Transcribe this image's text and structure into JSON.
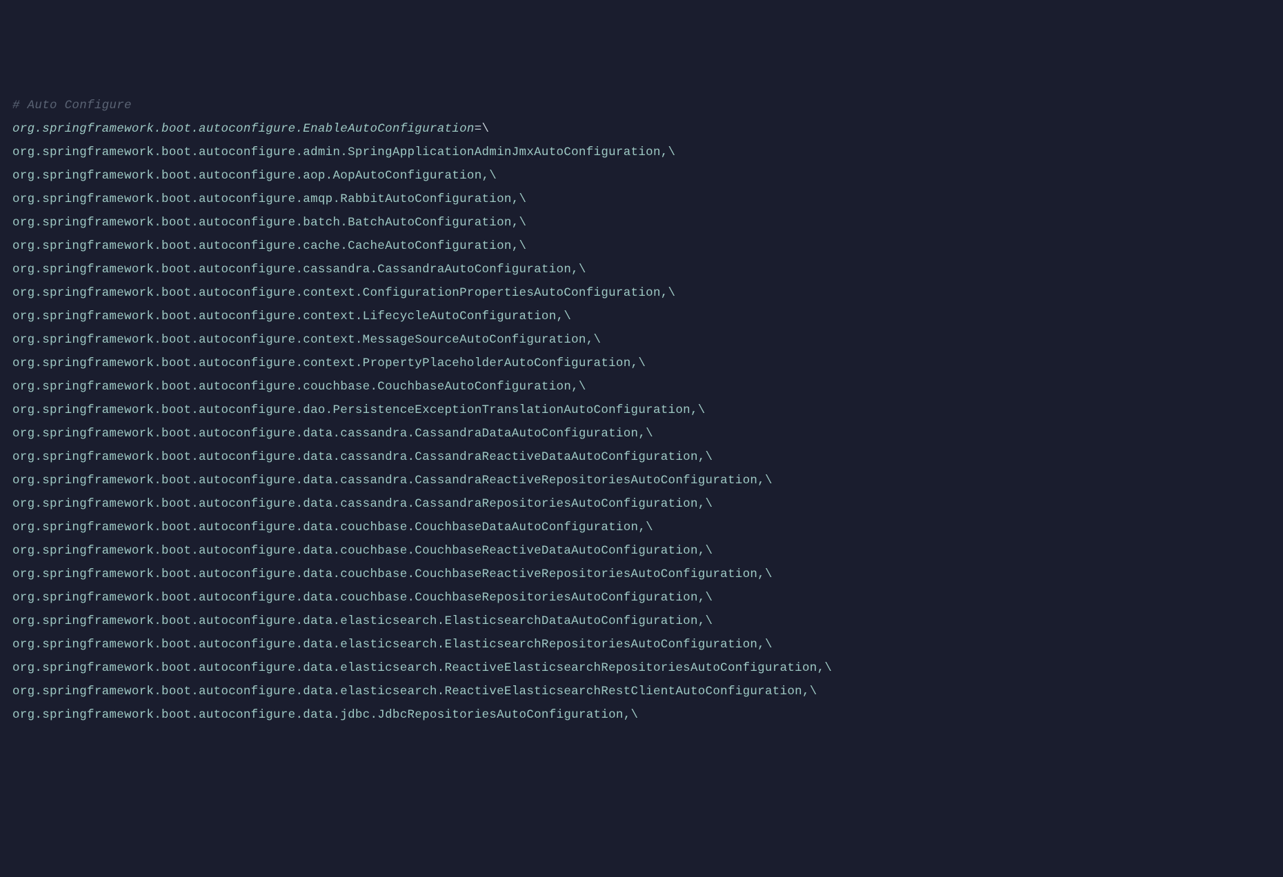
{
  "code": {
    "comment": "# Auto Configure",
    "key": "org.springframework.boot.autoconfigure.EnableAutoConfiguration",
    "equals_continuation": "=\\",
    "entries": [
      "org.springframework.boot.autoconfigure.admin.SpringApplicationAdminJmxAutoConfiguration,\\",
      "org.springframework.boot.autoconfigure.aop.AopAutoConfiguration,\\",
      "org.springframework.boot.autoconfigure.amqp.RabbitAutoConfiguration,\\",
      "org.springframework.boot.autoconfigure.batch.BatchAutoConfiguration,\\",
      "org.springframework.boot.autoconfigure.cache.CacheAutoConfiguration,\\",
      "org.springframework.boot.autoconfigure.cassandra.CassandraAutoConfiguration,\\",
      "org.springframework.boot.autoconfigure.context.ConfigurationPropertiesAutoConfiguration,\\",
      "org.springframework.boot.autoconfigure.context.LifecycleAutoConfiguration,\\",
      "org.springframework.boot.autoconfigure.context.MessageSourceAutoConfiguration,\\",
      "org.springframework.boot.autoconfigure.context.PropertyPlaceholderAutoConfiguration,\\",
      "org.springframework.boot.autoconfigure.couchbase.CouchbaseAutoConfiguration,\\",
      "org.springframework.boot.autoconfigure.dao.PersistenceExceptionTranslationAutoConfiguration,\\",
      "org.springframework.boot.autoconfigure.data.cassandra.CassandraDataAutoConfiguration,\\",
      "org.springframework.boot.autoconfigure.data.cassandra.CassandraReactiveDataAutoConfiguration,\\",
      "org.springframework.boot.autoconfigure.data.cassandra.CassandraReactiveRepositoriesAutoConfiguration,\\",
      "org.springframework.boot.autoconfigure.data.cassandra.CassandraRepositoriesAutoConfiguration,\\",
      "org.springframework.boot.autoconfigure.data.couchbase.CouchbaseDataAutoConfiguration,\\",
      "org.springframework.boot.autoconfigure.data.couchbase.CouchbaseReactiveDataAutoConfiguration,\\",
      "org.springframework.boot.autoconfigure.data.couchbase.CouchbaseReactiveRepositoriesAutoConfiguration,\\",
      "org.springframework.boot.autoconfigure.data.couchbase.CouchbaseRepositoriesAutoConfiguration,\\",
      "org.springframework.boot.autoconfigure.data.elasticsearch.ElasticsearchDataAutoConfiguration,\\",
      "org.springframework.boot.autoconfigure.data.elasticsearch.ElasticsearchRepositoriesAutoConfiguration,\\",
      "org.springframework.boot.autoconfigure.data.elasticsearch.ReactiveElasticsearchRepositoriesAutoConfiguration,\\",
      "org.springframework.boot.autoconfigure.data.elasticsearch.ReactiveElasticsearchRestClientAutoConfiguration,\\",
      "org.springframework.boot.autoconfigure.data.jdbc.JdbcRepositoriesAutoConfiguration,\\"
    ]
  }
}
